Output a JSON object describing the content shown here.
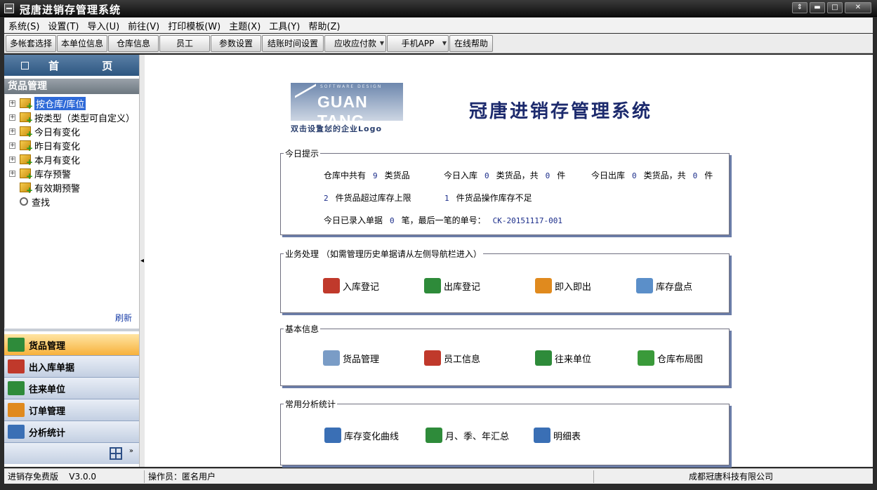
{
  "window": {
    "title": "冠唐进销存管理系统"
  },
  "menu": [
    "系统(S)",
    "设置(T)",
    "导入(U)",
    "前往(V)",
    "打印模板(W)",
    "主题(X)",
    "工具(Y)",
    "帮助(Z)"
  ],
  "toolbar": [
    {
      "label": "多帐套选择",
      "dropdown": false
    },
    {
      "label": "本单位信息",
      "dropdown": false
    },
    {
      "label": "仓库信息",
      "dropdown": false
    },
    {
      "label": "员工",
      "dropdown": false
    },
    {
      "label": "参数设置",
      "dropdown": false
    },
    {
      "label": "结账时间设置",
      "dropdown": false
    },
    {
      "label": "应收应付款",
      "dropdown": true
    },
    {
      "label": "手机APP",
      "dropdown": true
    },
    {
      "label": "在线帮助",
      "dropdown": false
    }
  ],
  "sidebar": {
    "home_label": "首  页",
    "section_title": "货品管理",
    "tree": [
      {
        "label": "按仓库/库位",
        "selected": true,
        "expandable": true,
        "icon": "warehouse-icon"
      },
      {
        "label": "按类型（类型可自定义）",
        "selected": false,
        "expandable": true,
        "icon": "cube-add-icon"
      },
      {
        "label": "今日有变化",
        "selected": false,
        "expandable": true,
        "icon": "cube-add-icon"
      },
      {
        "label": "昨日有变化",
        "selected": false,
        "expandable": true,
        "icon": "cube-add-icon"
      },
      {
        "label": "本月有变化",
        "selected": false,
        "expandable": true,
        "icon": "cube-add-icon"
      },
      {
        "label": "库存预警",
        "selected": false,
        "expandable": true,
        "icon": "cube-add-icon"
      },
      {
        "label": "有效期预警",
        "selected": false,
        "expandable": false,
        "icon": "cube-add-icon"
      },
      {
        "label": "查找",
        "selected": false,
        "expandable": false,
        "icon": "search-icon"
      }
    ],
    "refresh_label": "刷新",
    "nav": [
      {
        "label": "货品管理",
        "active": true,
        "icon": "book-icon",
        "color": "#2e8b3a"
      },
      {
        "label": "出入库单据",
        "active": false,
        "icon": "truck-icon",
        "color": "#c0392b"
      },
      {
        "label": "往来单位",
        "active": false,
        "icon": "truck-green-icon",
        "color": "#2e8b3a"
      },
      {
        "label": "订单管理",
        "active": false,
        "icon": "order-icon",
        "color": "#e08a1e"
      },
      {
        "label": "分析统计",
        "active": false,
        "icon": "chart-icon",
        "color": "#3a6fb5"
      }
    ]
  },
  "main": {
    "logo_brand": "GUAN TANG",
    "logo_tagline": "SOFTWARE DESIGN",
    "logo_caption": "双击设置您的企业Logo",
    "app_title": "冠唐进销存管理系统",
    "today": {
      "title": "今日提示",
      "stock_prefix": "仓库中共有",
      "stock_count": "9",
      "stock_suffix": "类货品",
      "in_prefix": "今日入库",
      "in_types": "0",
      "in_mid": "类货品，共",
      "in_count": "0",
      "in_suffix": "件",
      "out_prefix": "今日出库",
      "out_types": "0",
      "out_mid": "类货品，共",
      "out_count": "0",
      "out_suffix": "件",
      "over_count": "2",
      "over_text": "件货品超过库存上限",
      "under_count": "1",
      "under_text": "件货品操作库存不足",
      "entered_prefix": "今日已录入单据",
      "entered_count": "0",
      "entered_mid": "笔，最后一笔的单号：",
      "last_no": "CK-20151117-001"
    },
    "business": {
      "title": "业务处理 （如需管理历史单据请从左侧导航栏进入）",
      "items": [
        {
          "label": "入库登记",
          "icon": "stock-in-icon",
          "color": "#c0392b"
        },
        {
          "label": "出库登记",
          "icon": "stock-out-icon",
          "color": "#2e8b3a"
        },
        {
          "label": "即入即出",
          "icon": "in-out-icon",
          "color": "#e08a1e"
        },
        {
          "label": "库存盘点",
          "icon": "checklist-icon",
          "color": "#5b8fc9"
        }
      ]
    },
    "basic": {
      "title": "基本信息",
      "items": [
        {
          "label": "货品管理",
          "icon": "goods-icon",
          "color": "#7a9cc6"
        },
        {
          "label": "员工信息",
          "icon": "staff-icon",
          "color": "#c0392b"
        },
        {
          "label": "往来单位",
          "icon": "partner-icon",
          "color": "#2e8b3a"
        },
        {
          "label": "仓库布局图",
          "icon": "house-icon",
          "color": "#3a9a3a"
        }
      ]
    },
    "analysis": {
      "title": "常用分析统计",
      "items": [
        {
          "label": "库存变化曲线",
          "icon": "curve-icon",
          "color": "#3a6fb5"
        },
        {
          "label": "月、季、年汇总",
          "icon": "list-icon",
          "color": "#2e8b3a"
        },
        {
          "label": "明细表",
          "icon": "table-icon",
          "color": "#3a6fb5"
        }
      ]
    }
  },
  "status": {
    "edition": "进销存免费版",
    "version": "V3.0.0",
    "operator": "操作员：匿名用户",
    "company": "成都冠唐科技有限公司"
  }
}
